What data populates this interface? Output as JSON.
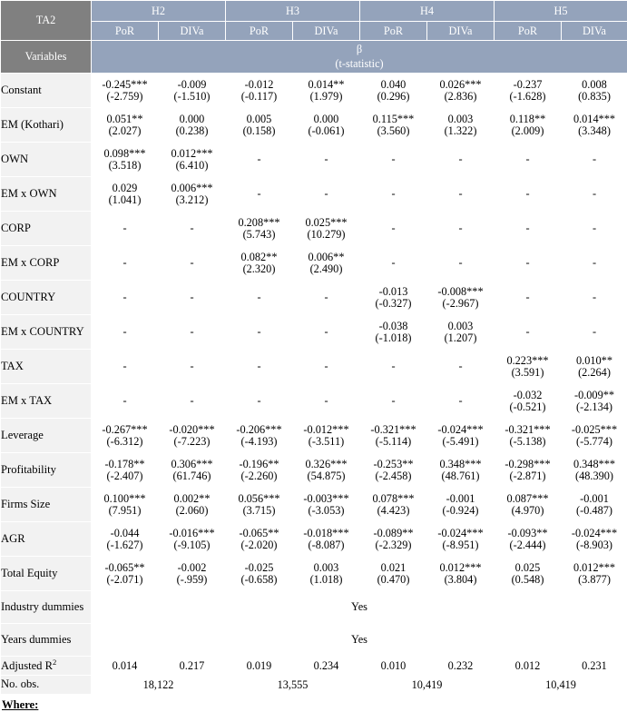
{
  "table": {
    "corner_label": "TA2",
    "variables_label": "Variables",
    "hypotheses": [
      "H2",
      "H3",
      "H4",
      "H5"
    ],
    "sub_headers": [
      "PoR",
      "DIVa",
      "PoR",
      "DIVa",
      "PoR",
      "DIVa",
      "PoR",
      "DIVa"
    ],
    "beta_line1": "β",
    "beta_line2": "(t-statistic)",
    "colors": {
      "header_dark": "#808080",
      "header_blue": "#94a3bb",
      "row_label_bg": "#f2f2f2",
      "grid": "#d9d9d9",
      "text": "#000000",
      "header_text": "#ffffff"
    },
    "rows": [
      {
        "label": "Constant",
        "cells": [
          {
            "coef": "-0.245***",
            "t": "(-2.759)"
          },
          {
            "coef": "-0.009",
            "t": "(-1.510)"
          },
          {
            "coef": "-0.012",
            "t": "(-0.117)"
          },
          {
            "coef": "0.014**",
            "t": "(1.979)"
          },
          {
            "coef": "0.040",
            "t": "(0.296)"
          },
          {
            "coef": "0.026***",
            "t": "(2.836)"
          },
          {
            "coef": "-0.237",
            "t": "(-1.628)"
          },
          {
            "coef": "0.008",
            "t": "(0.835)"
          }
        ]
      },
      {
        "label": "EM (Kothari)",
        "cells": [
          {
            "coef": "0.051**",
            "t": "(2.027)"
          },
          {
            "coef": "0.000",
            "t": "(0.238)"
          },
          {
            "coef": "0.005",
            "t": "(0.158)"
          },
          {
            "coef": "0.000",
            "t": "(-0.061)"
          },
          {
            "coef": "0.115***",
            "t": "(3.560)"
          },
          {
            "coef": "0.003",
            "t": "(1.322)"
          },
          {
            "coef": "0.118**",
            "t": "(2.009)"
          },
          {
            "coef": "0.014***",
            "t": "(3.348)"
          }
        ]
      },
      {
        "label": "OWN",
        "cells": [
          {
            "coef": "0.098***",
            "t": "(3.518)"
          },
          {
            "coef": "0.012***",
            "t": "(6.410)"
          },
          {
            "dash": "-"
          },
          {
            "dash": "-"
          },
          {
            "dash": "-"
          },
          {
            "dash": "-"
          },
          {
            "dash": "-"
          },
          {
            "dash": "-"
          }
        ]
      },
      {
        "label": "EM x OWN",
        "cells": [
          {
            "coef": "0.029",
            "t": "(1.041)"
          },
          {
            "coef": "0.006***",
            "t": "(3.212)"
          },
          {
            "dash": "-"
          },
          {
            "dash": "-"
          },
          {
            "dash": "-"
          },
          {
            "dash": "-"
          },
          {
            "dash": "-"
          },
          {
            "dash": "-"
          }
        ]
      },
      {
        "label": "CORP",
        "cells": [
          {
            "dash": "-"
          },
          {
            "dash": "-"
          },
          {
            "coef": "0.208***",
            "t": "(5.743)"
          },
          {
            "coef": "0.025***",
            "t": "(10.279)"
          },
          {
            "dash": "-"
          },
          {
            "dash": "-"
          },
          {
            "dash": "-"
          },
          {
            "dash": "-"
          }
        ]
      },
      {
        "label": "EM x CORP",
        "cells": [
          {
            "dash": "-"
          },
          {
            "dash": "-"
          },
          {
            "coef": "0.082**",
            "t": "(2.320)"
          },
          {
            "coef": "0.006**",
            "t": "(2.490)"
          },
          {
            "dash": "-"
          },
          {
            "dash": "-"
          },
          {
            "dash": "-"
          },
          {
            "dash": "-"
          }
        ]
      },
      {
        "label": "COUNTRY",
        "cells": [
          {
            "dash": "-"
          },
          {
            "dash": "-"
          },
          {
            "dash": "-"
          },
          {
            "dash": "-"
          },
          {
            "coef": "-0.013",
            "t": "(-0.327)"
          },
          {
            "coef": "-0.008***",
            "t": "(-2.967)"
          },
          {
            "dash": "-"
          },
          {
            "dash": "-"
          }
        ]
      },
      {
        "label": "EM x COUNTRY",
        "cells": [
          {
            "dash": "-"
          },
          {
            "dash": "-"
          },
          {
            "dash": "-"
          },
          {
            "dash": "-"
          },
          {
            "coef": "-0.038",
            "t": "(-1.018)"
          },
          {
            "coef": "0.003",
            "t": "(1.207)"
          },
          {
            "dash": "-"
          },
          {
            "dash": "-"
          }
        ]
      },
      {
        "label": "TAX",
        "cells": [
          {
            "dash": "-"
          },
          {
            "dash": "-"
          },
          {
            "dash": "-"
          },
          {
            "dash": "-"
          },
          {
            "dash": "-"
          },
          {
            "dash": "-"
          },
          {
            "coef": "0.223***",
            "t": "(3.591)"
          },
          {
            "coef": "0.010**",
            "t": "(2.264)"
          }
        ]
      },
      {
        "label": "EM x TAX",
        "cells": [
          {
            "dash": "-"
          },
          {
            "dash": "-"
          },
          {
            "dash": "-"
          },
          {
            "dash": "-"
          },
          {
            "dash": "-"
          },
          {
            "dash": "-"
          },
          {
            "coef": "-0.032",
            "t": "(-0.521)"
          },
          {
            "coef": "-0.009**",
            "t": "(-2.134)"
          }
        ]
      },
      {
        "label": "Leverage",
        "cells": [
          {
            "coef": "-0.267***",
            "t": "(-6.312)"
          },
          {
            "coef": "-0.020***",
            "t": "(-7.223)"
          },
          {
            "coef": "-0.206***",
            "t": "(-4.193)"
          },
          {
            "coef": "-0.012***",
            "t": "(-3.511)"
          },
          {
            "coef": "-0.321***",
            "t": "(-5.114)"
          },
          {
            "coef": "-0.024***",
            "t": "(-5.491)"
          },
          {
            "coef": "-0.321***",
            "t": "(-5.138)"
          },
          {
            "coef": "-0.025***",
            "t": "(-5.774)"
          }
        ]
      },
      {
        "label": "Profitability",
        "cells": [
          {
            "coef": "-0.178**",
            "t": "(-2.407)"
          },
          {
            "coef": "0.306***",
            "t": "(61.746)"
          },
          {
            "coef": "-0.196**",
            "t": "(-2.260)"
          },
          {
            "coef": "0.326***",
            "t": "(54.875)"
          },
          {
            "coef": "-0.253**",
            "t": "(-2.458)"
          },
          {
            "coef": "0.348***",
            "t": "(48.761)"
          },
          {
            "coef": "-0.298***",
            "t": "(-2.871)"
          },
          {
            "coef": "0.348***",
            "t": "(48.390)"
          }
        ]
      },
      {
        "label": "Firms Size",
        "cells": [
          {
            "coef": "0.100***",
            "t": "(7.951)"
          },
          {
            "coef": "0.002**",
            "t": "(2.060)"
          },
          {
            "coef": "0.056***",
            "t": "(3.715)"
          },
          {
            "coef": "-0.003***",
            "t": "(-3.053)"
          },
          {
            "coef": "0.078***",
            "t": "(4.423)"
          },
          {
            "coef": "-0.001",
            "t": "(-0.924)"
          },
          {
            "coef": "0.087***",
            "t": "(4.970)"
          },
          {
            "coef": "-0.001",
            "t": "(-0.487)"
          }
        ]
      },
      {
        "label": "AGR",
        "cells": [
          {
            "coef": "-0.044",
            "t": "(-1.627)"
          },
          {
            "coef": "-0.016***",
            "t": "(-9.105)"
          },
          {
            "coef": "-0.065**",
            "t": "(-2.020)"
          },
          {
            "coef": "-0.018***",
            "t": "(-8.087)"
          },
          {
            "coef": "-0.089**",
            "t": "(-2.329)"
          },
          {
            "coef": "-0.024***",
            "t": "(-8.951)"
          },
          {
            "coef": "-0.093**",
            "t": "(-2.444)"
          },
          {
            "coef": "-0.024***",
            "t": "(-8.903)"
          }
        ]
      },
      {
        "label": "Total Equity",
        "cells": [
          {
            "coef": "-0.065**",
            "t": "(-2.071)"
          },
          {
            "coef": "-0.002",
            "t": "(-.959)"
          },
          {
            "coef": "-0.025",
            "t": "(-0.658)"
          },
          {
            "coef": "0.003",
            "t": "(1.018)"
          },
          {
            "coef": "0.021",
            "t": "(0.470)"
          },
          {
            "coef": "0.012***",
            "t": "(3.804)"
          },
          {
            "coef": "0.025",
            "t": "(0.548)"
          },
          {
            "coef": "0.012***",
            "t": "(3.877)"
          }
        ]
      }
    ],
    "industry_dummies": {
      "label": "Industry dummies",
      "value": "Yes"
    },
    "years_dummies": {
      "label": "Years dummies",
      "value": "Yes"
    },
    "adjusted_r2": {
      "label_main": "Adjusted R",
      "label_sup": "2",
      "values": [
        "0.014",
        "0.217",
        "0.019",
        "0.234",
        "0.010",
        "0.232",
        "0.012",
        "0.231"
      ]
    },
    "no_obs": {
      "label": "No. obs.",
      "values": [
        "18,122",
        "13,555",
        "10,419",
        "10,419"
      ]
    }
  },
  "footer": {
    "where_label": "Where:"
  }
}
